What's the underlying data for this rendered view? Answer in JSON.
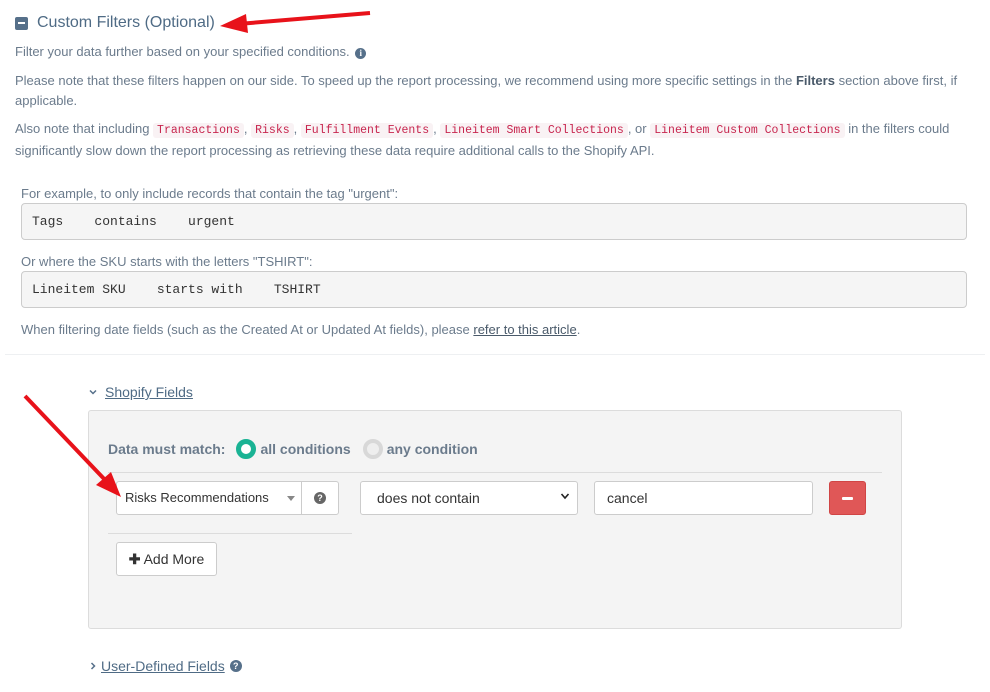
{
  "header": {
    "title": "Custom Filters (Optional)"
  },
  "intro": {
    "line1": "Filter your data further based on your specified conditions.",
    "note1_a": "Please note that these filters happen on our side. To speed up the report processing, we recommend using more specific settings in the ",
    "note1_bold": "Filters",
    "note1_b": " section above first, if applicable.",
    "note2_a": "Also note that including ",
    "pills": [
      "Transactions",
      "Risks",
      "Fulfillment Events",
      "Lineitem Smart Collections",
      "Lineitem Custom Collections"
    ],
    "sep_comma": ",",
    "sep_or": ", or",
    "note2_b": " in the filters could significantly slow down the report processing as retrieving these data require additional calls to the Shopify API."
  },
  "examples": {
    "ex1_caption": "For example, to only include records that contain the tag \"urgent\":",
    "ex1_code": "Tags    contains    urgent",
    "ex2_caption": "Or where the SKU starts with the letters \"TSHIRT\":",
    "ex2_code": "Lineitem SKU    starts with    TSHIRT",
    "date_note_a": "When filtering date fields (such as the Created At or Updated At fields), please ",
    "date_note_link": "refer to this article",
    "date_note_b": "."
  },
  "shopify_fields": {
    "label": "Shopify Fields",
    "match_label": "Data must match:",
    "match_all": "all conditions",
    "match_any": "any condition",
    "selected_match": "all conditions",
    "rule": {
      "field": "Risks Recommendations",
      "operator": "does not contain",
      "value": "cancel"
    },
    "add_more": "Add More"
  },
  "user_defined": {
    "label": "User-Defined Fields"
  },
  "colors": {
    "accent": "#1ab394",
    "danger": "#e05757",
    "annotation_arrow": "#e8121a"
  }
}
